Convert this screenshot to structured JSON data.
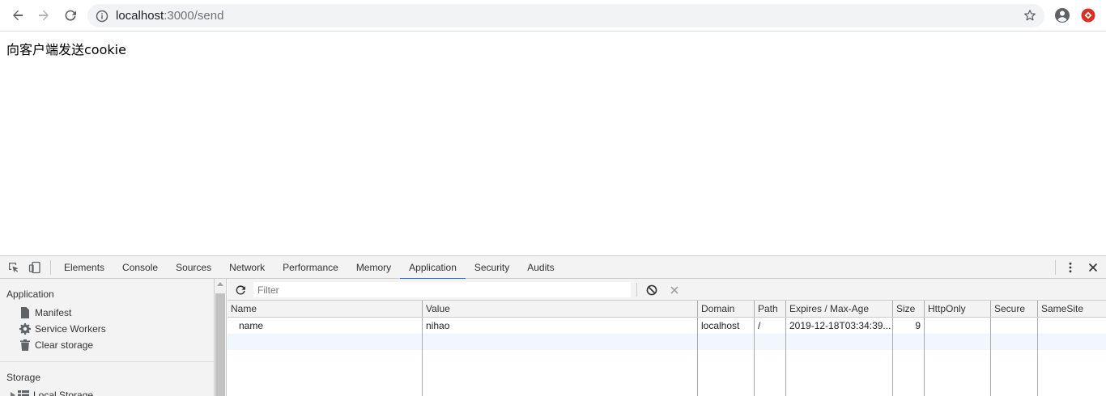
{
  "browser": {
    "url_host": "localhost",
    "url_rest": ":3000/send",
    "colors": {
      "accent": "#1a73e8",
      "extension": "#d93025"
    },
    "icons": [
      "back-arrow-icon",
      "forward-arrow-icon",
      "reload-icon",
      "info-icon",
      "star-icon",
      "account-icon",
      "extension-icon"
    ]
  },
  "page": {
    "heading": "向客户端发送cookie"
  },
  "devtools": {
    "tabs": [
      {
        "label": "Elements",
        "active": false
      },
      {
        "label": "Console",
        "active": false
      },
      {
        "label": "Sources",
        "active": false
      },
      {
        "label": "Network",
        "active": false
      },
      {
        "label": "Performance",
        "active": false
      },
      {
        "label": "Memory",
        "active": false
      },
      {
        "label": "Application",
        "active": true
      },
      {
        "label": "Security",
        "active": false
      },
      {
        "label": "Audits",
        "active": false
      }
    ],
    "sidebar": {
      "application_title": "Application",
      "items": [
        {
          "label": "Manifest",
          "icon": "file-icon"
        },
        {
          "label": "Service Workers",
          "icon": "gear-icon"
        },
        {
          "label": "Clear storage",
          "icon": "trash-icon"
        }
      ],
      "storage_title": "Storage",
      "storage_items": [
        {
          "label": "Local Storage",
          "icon": "grid-icon"
        }
      ]
    },
    "filter": {
      "placeholder": "Filter"
    },
    "cookies": {
      "columns": [
        "Name",
        "Value",
        "Domain",
        "Path",
        "Expires / Max-Age",
        "Size",
        "HttpOnly",
        "Secure",
        "SameSite"
      ],
      "rows": [
        {
          "name": "name",
          "value": "nihao",
          "domain": "localhost",
          "path": "/",
          "expires": "2019-12-18T03:34:39...",
          "size": "9",
          "httponly": "",
          "secure": "",
          "samesite": ""
        }
      ]
    }
  }
}
